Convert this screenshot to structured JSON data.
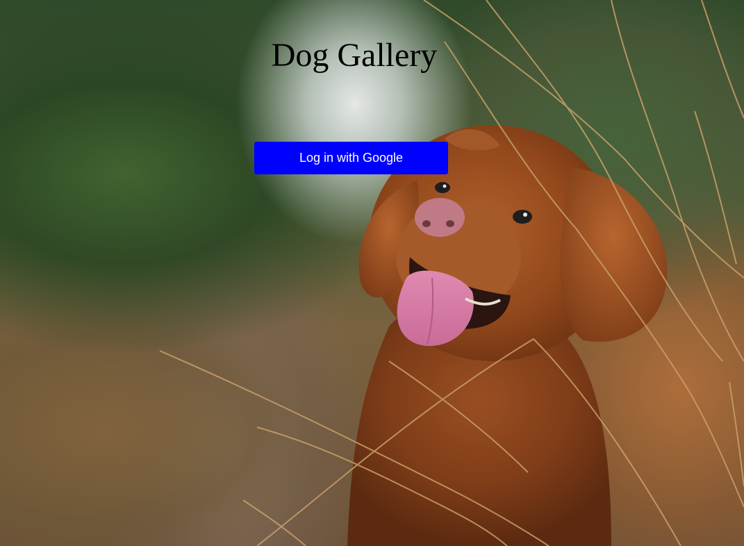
{
  "page": {
    "title": "Dog Gallery"
  },
  "login": {
    "button_label": "Log in with Google",
    "button_color": "#0000ff",
    "text_color": "#ffffff"
  },
  "background": {
    "subject": "dog-photo"
  }
}
